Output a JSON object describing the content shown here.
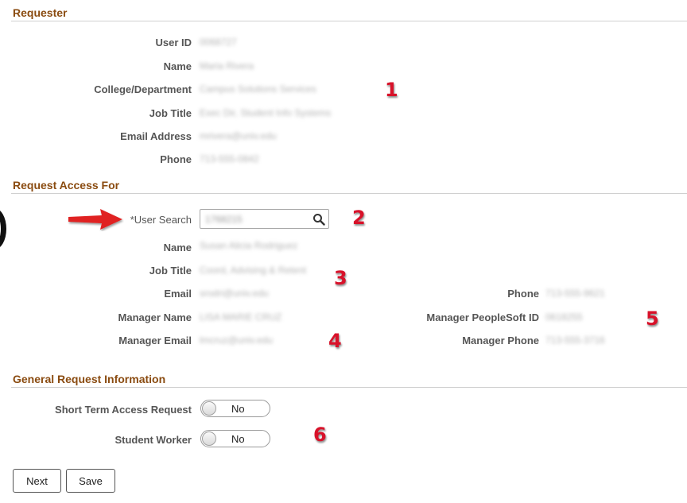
{
  "requester": {
    "title": "Requester",
    "fields": [
      {
        "label": "User ID",
        "value": "0068727"
      },
      {
        "label": "Name",
        "value": "Maria Rivera"
      },
      {
        "label": "College/Department",
        "value": "Campus Solutions Services"
      },
      {
        "label": "Job Title",
        "value": "Exec Dir, Student Info Systems"
      },
      {
        "label": "Email Address",
        "value": "mrivera@univ.edu"
      },
      {
        "label": "Phone",
        "value": "713-555-0842"
      }
    ]
  },
  "request_access": {
    "title": "Request Access For",
    "user_search_label": "*User Search",
    "user_search_value": "1768215",
    "name_label": "Name",
    "name_value": "Susan Alicia Rodriguez",
    "job_title_label": "Job Title",
    "job_title_value": "Coord, Advising & Retent",
    "email_label": "Email",
    "email_value": "srodri@univ.edu",
    "phone_label": "Phone",
    "phone_value": "713-555-9621",
    "manager_name_label": "Manager Name",
    "manager_name_value": "LISA MARIE CRUZ",
    "manager_psid_label": "Manager PeopleSoft ID",
    "manager_psid_value": "0618255",
    "manager_email_label": "Manager Email",
    "manager_email_value": "lmcruz@univ.edu",
    "manager_phone_label": "Manager Phone",
    "manager_phone_value": "713-555-3716"
  },
  "general": {
    "title": "General Request Information",
    "short_term_label": "Short Term Access Request",
    "short_term_value": "No",
    "student_worker_label": "Student Worker",
    "student_worker_value": "No"
  },
  "buttons": {
    "next": "Next",
    "save": "Save"
  },
  "callouts": [
    "1",
    "2",
    "3",
    "4",
    "5",
    "6"
  ],
  "colors": {
    "section_title": "#8a4b10",
    "callout": "#d8122a",
    "arrow": "#e02020"
  }
}
